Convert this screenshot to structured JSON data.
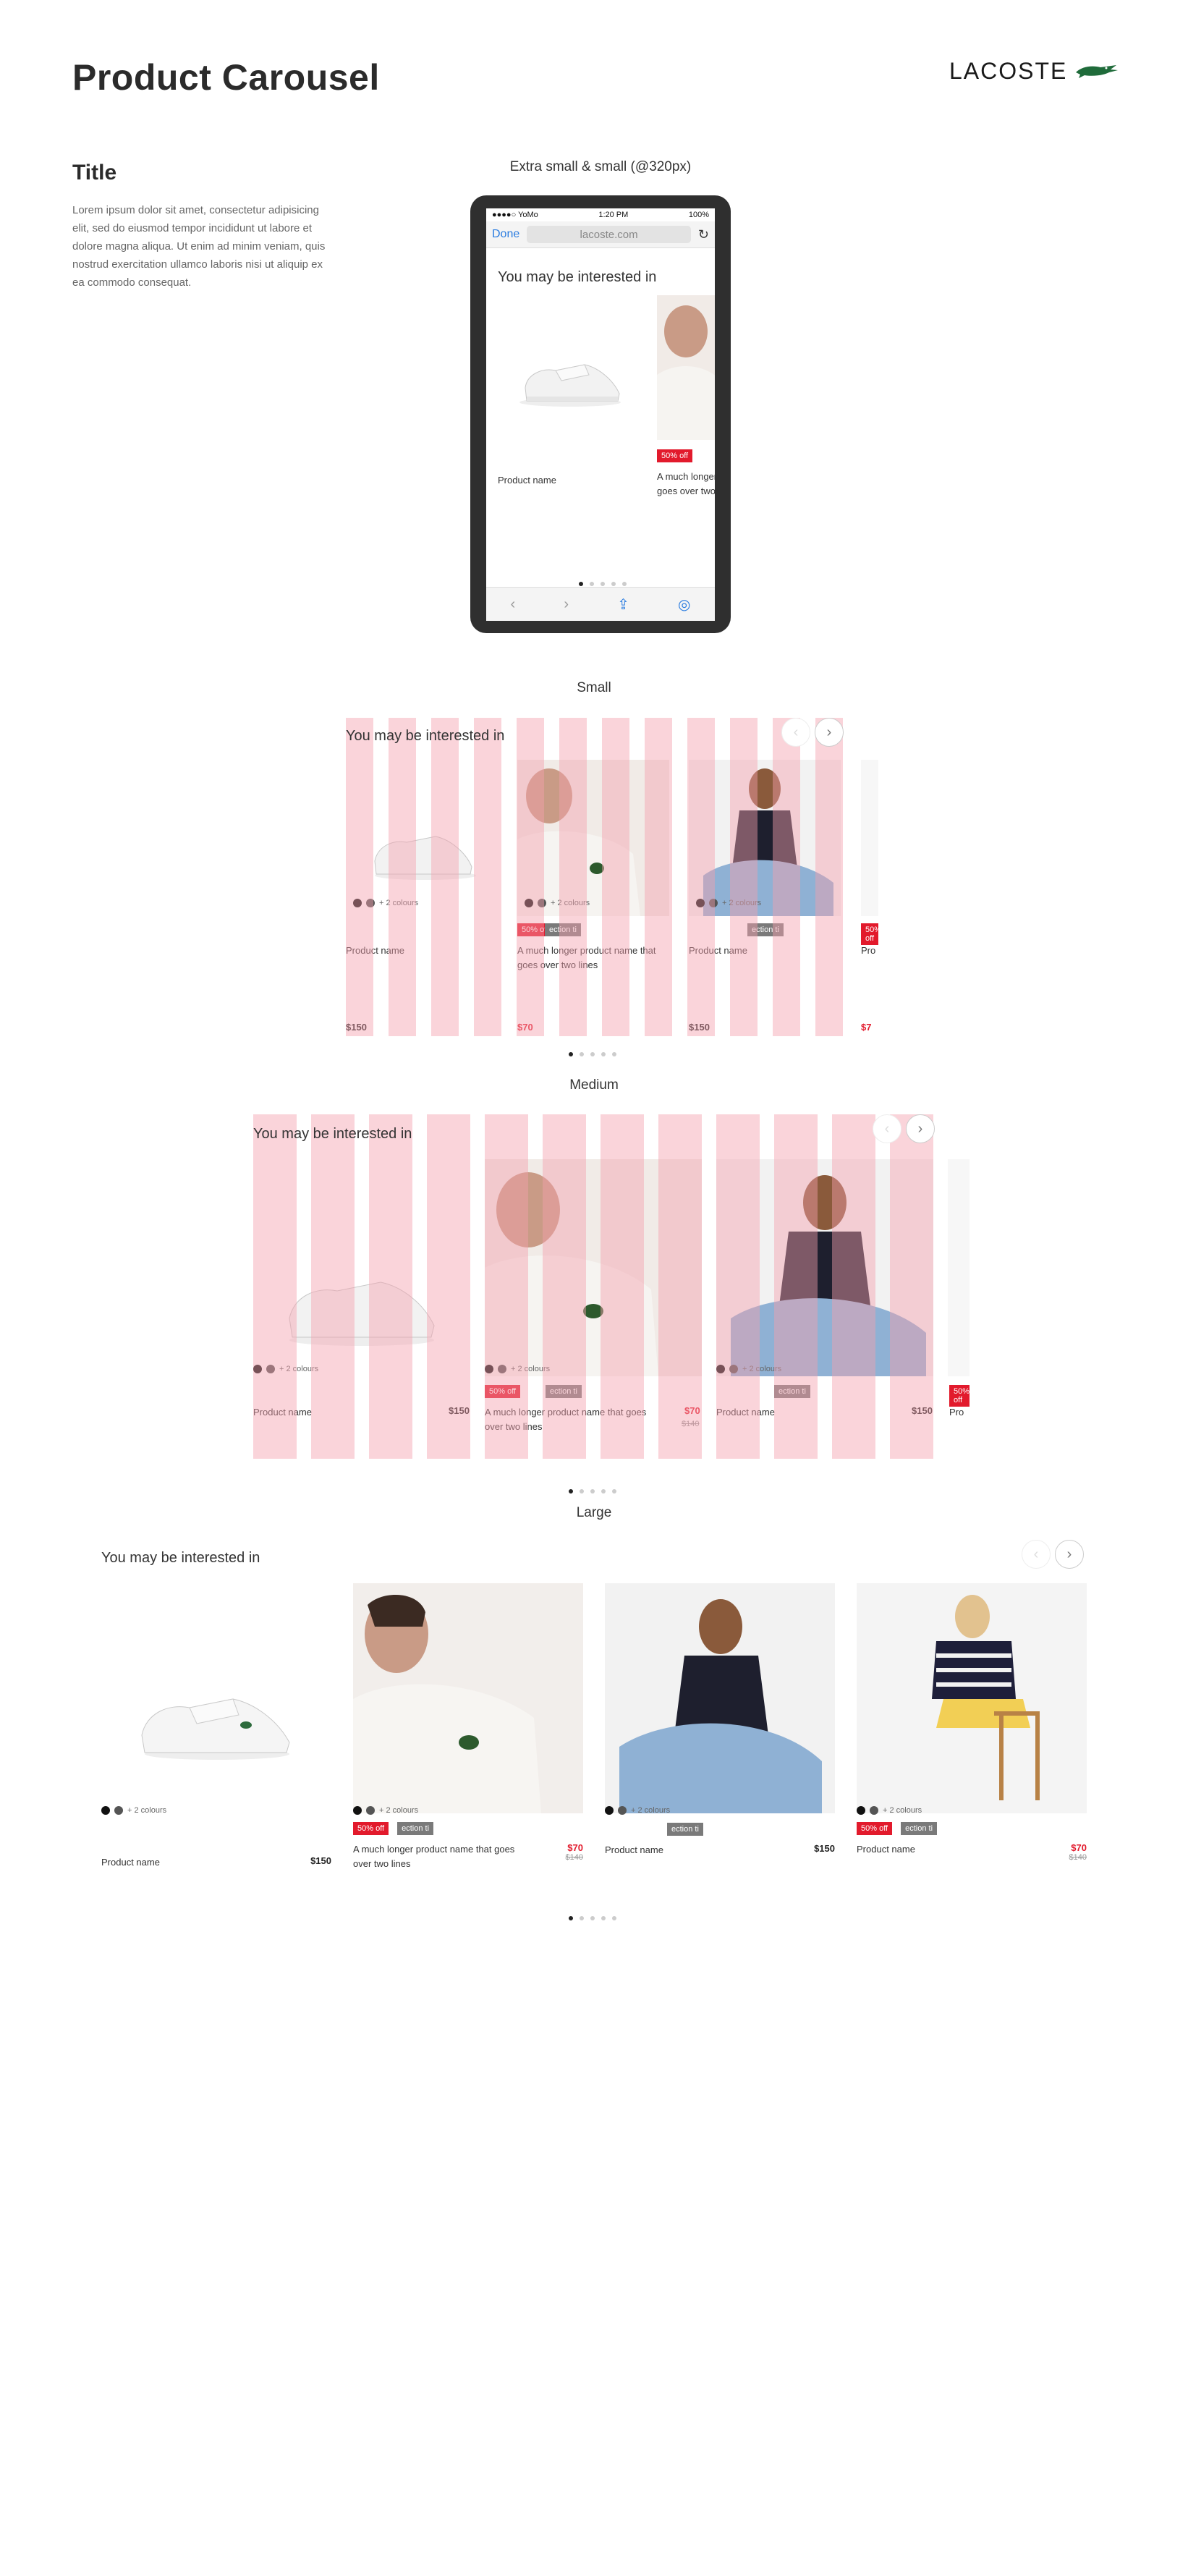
{
  "header": {
    "page_title": "Product Carousel",
    "brand": "LACOSTE",
    "section_title": "Title",
    "description": "Lorem ipsum dolor sit amet, consectetur adipisicing elit, sed do eiusmod tempor incididunt ut labore et dolore magna aliqua. Ut enim ad minim veniam, quis nostrud exercitation ullamco laboris nisi ut aliquip ex ea commodo consequat."
  },
  "breakpoints": {
    "xs": "Extra small & small (@320px)",
    "small": "Small",
    "medium": "Medium",
    "large": "Large"
  },
  "phone": {
    "carrier": "●●●●○ YoMo",
    "time": "1:20 PM",
    "battery": "100%",
    "done": "Done",
    "url": "lacoste.com"
  },
  "carousel": {
    "title": "You may be interested in",
    "colours": "+ 2 colours",
    "discount": "50% off",
    "collection": "ection ti",
    "products": [
      {
        "name": "Product name",
        "price": "$150",
        "old_price": ""
      },
      {
        "name": "A much longer product name that goes over two lines",
        "price": "$70",
        "old_price": "$140"
      },
      {
        "name": "Product name",
        "price": "$150",
        "old_price": ""
      },
      {
        "name": "Product name",
        "price": "$70",
        "old_price": "$140"
      }
    ],
    "xs_second_name": "A much longer product name that goes over two lines",
    "arrow_prev": "‹",
    "arrow_next": "›"
  },
  "colors": {
    "accent_red": "#e21a2c",
    "grid_pink": "#f3a0ac",
    "link_blue": "#2a7ce0"
  }
}
